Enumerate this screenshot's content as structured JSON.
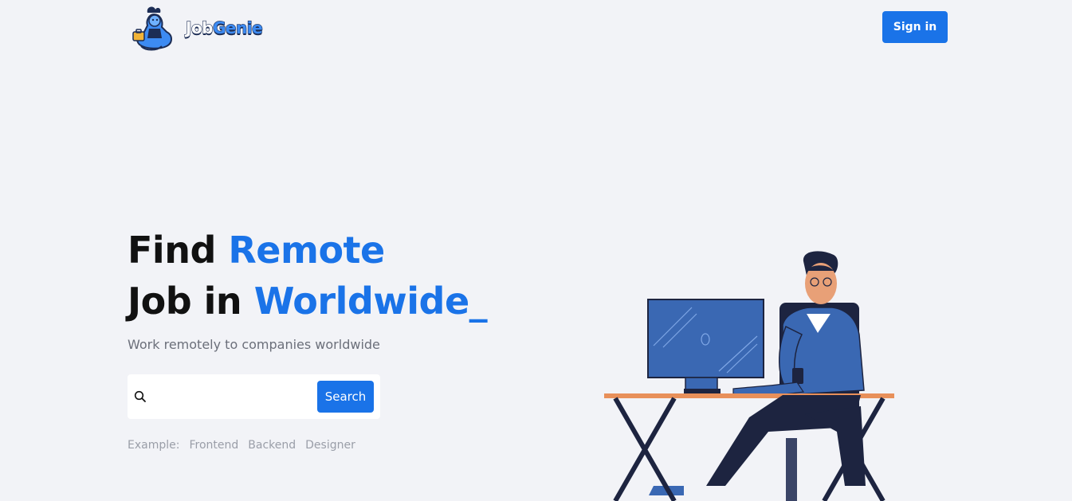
{
  "header": {
    "logo": {
      "text_job": "Job",
      "text_genie": "Genie",
      "mascot_icon": "genie-mascot-icon"
    },
    "signin_label": "Sign in"
  },
  "hero": {
    "title_line1_plain": "Find ",
    "title_line1_accent": "Remote",
    "title_line2_plain": "Job in ",
    "title_line2_accent": "Worldwide_",
    "subtitle": "Work remotely to companies worldwide"
  },
  "search": {
    "icon": "search-icon",
    "value": "",
    "placeholder": "",
    "button_label": "Search"
  },
  "examples": {
    "label": "Example:",
    "items": [
      "Frontend",
      "Backend",
      "Designer"
    ]
  },
  "illustration": {
    "description_icon": "person-at-desk-illustration"
  },
  "colors": {
    "background": "#f2f3f7",
    "accent": "#1a73e8",
    "subtitle": "#6b6f7a",
    "examples": "#9a9ea8"
  }
}
